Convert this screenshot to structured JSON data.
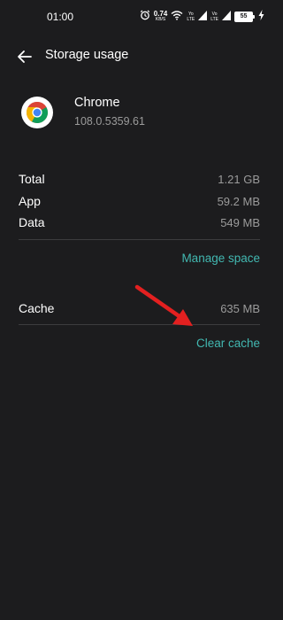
{
  "status_bar": {
    "time": "01:00",
    "net_speed": "0.74",
    "net_speed_unit": "KB/S",
    "net_type_top": "Yo",
    "net_type_bottom": "LTE",
    "net_type_b_top": "Vo",
    "net_type_b_bottom": "LTE",
    "battery": "55",
    "icons": [
      "alarm-icon",
      "wifi-icon",
      "signal-icon",
      "battery-icon",
      "charging-icon"
    ]
  },
  "header": {
    "title": "Storage usage",
    "back_icon": "arrow-left-icon"
  },
  "app": {
    "name": "Chrome",
    "version": "108.0.5359.61",
    "icon": "chrome-icon"
  },
  "storage": {
    "rows": [
      {
        "label": "Total",
        "value": "1.21 GB"
      },
      {
        "label": "App",
        "value": "59.2 MB"
      },
      {
        "label": "Data",
        "value": "549 MB"
      }
    ],
    "manage_label": "Manage space"
  },
  "cache": {
    "label": "Cache",
    "value": "635 MB",
    "clear_label": "Clear cache"
  },
  "colors": {
    "background": "#1c1c1e",
    "accent": "#42b8b1",
    "secondary_text": "#9b9b9b",
    "annotation_arrow": "#e32020"
  }
}
